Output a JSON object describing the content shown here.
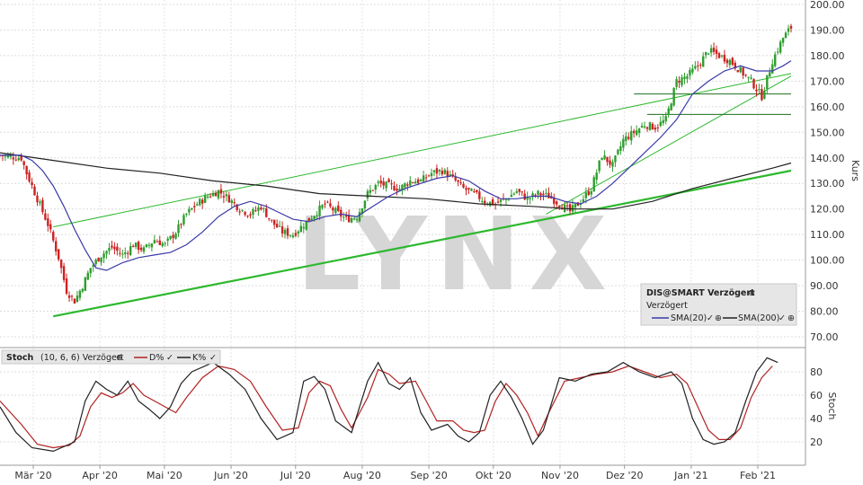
{
  "chart_data": [
    {
      "type": "candlestick",
      "symbol_label": "DIS@SMART Verzögert",
      "subtitle": "Verzögert",
      "ylabel": "Kurs",
      "ylim": [
        63,
        200
      ],
      "yticks": [
        "70.00",
        "80.00",
        "90.00",
        "100.00",
        "110.00",
        "120.00",
        "130.00",
        "140.00",
        "150.00",
        "160.00",
        "170.00",
        "180.00",
        "190.00",
        "200.00"
      ],
      "grid": true,
      "legend_position": "bottom-right",
      "watermark": "LYNX",
      "colors": {
        "up": "#2e9e2e",
        "down": "#cc2222",
        "sma20": "#3a3aa8",
        "sma200": "#222222",
        "trend": "#2db82d",
        "level": "#1f6f1f"
      },
      "x_start": "2020-02-20",
      "close_path": [
        [
          0,
          141
        ],
        [
          8,
          140
        ],
        [
          10,
          134
        ],
        [
          14,
          124
        ],
        [
          18,
          114
        ],
        [
          22,
          101
        ],
        [
          25,
          88
        ],
        [
          28,
          84
        ],
        [
          31,
          90
        ],
        [
          34,
          97
        ],
        [
          38,
          102
        ],
        [
          42,
          105
        ],
        [
          46,
          102
        ],
        [
          50,
          106
        ],
        [
          54,
          104
        ],
        [
          58,
          108
        ],
        [
          62,
          106
        ],
        [
          66,
          111
        ],
        [
          70,
          118
        ],
        [
          74,
          122
        ],
        [
          78,
          125
        ],
        [
          82,
          127
        ],
        [
          86,
          124
        ],
        [
          90,
          120
        ],
        [
          94,
          118
        ],
        [
          98,
          121
        ],
        [
          102,
          115
        ],
        [
          106,
          111
        ],
        [
          110,
          110
        ],
        [
          114,
          114
        ],
        [
          118,
          118
        ],
        [
          122,
          122
        ],
        [
          126,
          119
        ],
        [
          130,
          116
        ],
        [
          134,
          117
        ],
        [
          138,
          126
        ],
        [
          142,
          130
        ],
        [
          146,
          129
        ],
        [
          150,
          128
        ],
        [
          154,
          131
        ],
        [
          158,
          131
        ],
        [
          162,
          134
        ],
        [
          166,
          135
        ],
        [
          170,
          132
        ],
        [
          174,
          128
        ],
        [
          178,
          126
        ],
        [
          182,
          123
        ],
        [
          186,
          122
        ],
        [
          190,
          124
        ],
        [
          194,
          127
        ],
        [
          198,
          124
        ],
        [
          202,
          126
        ],
        [
          206,
          125
        ],
        [
          210,
          122
        ],
        [
          214,
          119
        ],
        [
          218,
          123
        ],
        [
          222,
          128
        ],
        [
          226,
          141
        ],
        [
          230,
          137
        ],
        [
          234,
          147
        ],
        [
          238,
          150
        ],
        [
          242,
          153
        ],
        [
          246,
          152
        ],
        [
          250,
          155
        ],
        [
          254,
          170
        ],
        [
          258,
          172
        ],
        [
          262,
          176
        ],
        [
          266,
          182
        ],
        [
          270,
          180
        ],
        [
          274,
          178
        ],
        [
          278,
          174
        ],
        [
          282,
          170
        ],
        [
          286,
          164
        ],
        [
          290,
          178
        ],
        [
          294,
          187
        ],
        [
          297,
          191
        ]
      ],
      "sma20_path": [
        [
          0,
          141
        ],
        [
          8,
          141
        ],
        [
          12,
          139
        ],
        [
          16,
          135
        ],
        [
          20,
          129
        ],
        [
          24,
          121
        ],
        [
          28,
          112
        ],
        [
          32,
          104
        ],
        [
          36,
          97
        ],
        [
          40,
          96
        ],
        [
          46,
          99
        ],
        [
          52,
          101
        ],
        [
          58,
          102
        ],
        [
          64,
          103
        ],
        [
          70,
          106
        ],
        [
          76,
          111
        ],
        [
          82,
          117
        ],
        [
          88,
          121
        ],
        [
          94,
          123
        ],
        [
          100,
          121
        ],
        [
          104,
          119
        ],
        [
          110,
          116
        ],
        [
          116,
          115
        ],
        [
          122,
          117
        ],
        [
          128,
          118
        ],
        [
          134,
          117
        ],
        [
          140,
          121
        ],
        [
          146,
          125
        ],
        [
          152,
          128
        ],
        [
          158,
          130
        ],
        [
          164,
          132
        ],
        [
          170,
          133
        ],
        [
          176,
          131
        ],
        [
          182,
          127
        ],
        [
          188,
          124
        ],
        [
          194,
          124
        ],
        [
          200,
          125
        ],
        [
          206,
          125
        ],
        [
          212,
          123
        ],
        [
          218,
          122
        ],
        [
          224,
          125
        ],
        [
          230,
          130
        ],
        [
          236,
          136
        ],
        [
          242,
          142
        ],
        [
          248,
          148
        ],
        [
          254,
          155
        ],
        [
          260,
          165
        ],
        [
          266,
          170
        ],
        [
          272,
          174
        ],
        [
          278,
          176
        ],
        [
          284,
          174
        ],
        [
          290,
          174
        ],
        [
          294,
          176
        ],
        [
          297,
          178
        ]
      ],
      "sma200_path": [
        [
          0,
          142
        ],
        [
          20,
          139
        ],
        [
          40,
          136
        ],
        [
          60,
          134
        ],
        [
          80,
          131
        ],
        [
          100,
          129
        ],
        [
          120,
          126
        ],
        [
          140,
          125
        ],
        [
          160,
          124
        ],
        [
          180,
          122
        ],
        [
          200,
          121
        ],
        [
          215,
          120
        ],
        [
          230,
          120
        ],
        [
          245,
          123
        ],
        [
          260,
          128
        ],
        [
          275,
          132
        ],
        [
          290,
          136
        ],
        [
          297,
          138
        ]
      ],
      "trendlines": [
        {
          "from": [
            20,
            78
          ],
          "to": [
            297,
            135
          ]
        },
        {
          "from": [
            20,
            113
          ],
          "to": [
            297,
            173
          ]
        },
        {
          "from": [
            205,
            118
          ],
          "to": [
            297,
            172
          ]
        }
      ],
      "levels": [
        {
          "y": 165,
          "x_from": 238,
          "x_to": 297
        },
        {
          "y": 157,
          "x_from": 243,
          "x_to": 297
        }
      ],
      "legend": [
        "SMA(20)",
        "SMA(200)"
      ]
    },
    {
      "type": "line",
      "title": "Stoch",
      "params": "(10, 6, 6) Verzögert",
      "ylabel": "Stoch",
      "ylim": [
        0,
        100
      ],
      "yticks": [
        "20",
        "40",
        "60",
        "80"
      ],
      "series": [
        {
          "name": "D%",
          "color": "#b22222",
          "points": [
            [
              0,
              55
            ],
            [
              8,
              35
            ],
            [
              14,
              18
            ],
            [
              20,
              15
            ],
            [
              26,
              17
            ],
            [
              30,
              25
            ],
            [
              34,
              50
            ],
            [
              38,
              62
            ],
            [
              42,
              58
            ],
            [
              46,
              62
            ],
            [
              50,
              70
            ],
            [
              54,
              60
            ],
            [
              58,
              55
            ],
            [
              62,
              50
            ],
            [
              66,
              45
            ],
            [
              70,
              58
            ],
            [
              76,
              75
            ],
            [
              82,
              85
            ],
            [
              88,
              82
            ],
            [
              94,
              72
            ],
            [
              100,
              50
            ],
            [
              106,
              30
            ],
            [
              112,
              32
            ],
            [
              116,
              62
            ],
            [
              120,
              72
            ],
            [
              124,
              68
            ],
            [
              128,
              48
            ],
            [
              132,
              32
            ],
            [
              138,
              58
            ],
            [
              142,
              82
            ],
            [
              146,
              78
            ],
            [
              150,
              70
            ],
            [
              156,
              72
            ],
            [
              160,
              55
            ],
            [
              164,
              38
            ],
            [
              170,
              38
            ],
            [
              174,
              30
            ],
            [
              178,
              28
            ],
            [
              182,
              30
            ],
            [
              186,
              55
            ],
            [
              190,
              70
            ],
            [
              194,
              60
            ],
            [
              198,
              45
            ],
            [
              202,
              25
            ],
            [
              206,
              45
            ],
            [
              212,
              72
            ],
            [
              218,
              75
            ],
            [
              224,
              78
            ],
            [
              230,
              80
            ],
            [
              236,
              85
            ],
            [
              242,
              80
            ],
            [
              248,
              75
            ],
            [
              254,
              78
            ],
            [
              258,
              70
            ],
            [
              262,
              50
            ],
            [
              266,
              30
            ],
            [
              270,
              22
            ],
            [
              274,
              22
            ],
            [
              278,
              32
            ],
            [
              282,
              58
            ],
            [
              286,
              75
            ],
            [
              290,
              85
            ]
          ]
        },
        {
          "name": "K%",
          "color": "#222222",
          "points": [
            [
              0,
              50
            ],
            [
              6,
              28
            ],
            [
              12,
              15
            ],
            [
              20,
              12
            ],
            [
              28,
              20
            ],
            [
              32,
              55
            ],
            [
              36,
              72
            ],
            [
              40,
              65
            ],
            [
              44,
              60
            ],
            [
              48,
              72
            ],
            [
              52,
              55
            ],
            [
              56,
              48
            ],
            [
              60,
              40
            ],
            [
              64,
              50
            ],
            [
              68,
              70
            ],
            [
              72,
              80
            ],
            [
              80,
              88
            ],
            [
              86,
              78
            ],
            [
              92,
              65
            ],
            [
              98,
              40
            ],
            [
              104,
              22
            ],
            [
              110,
              28
            ],
            [
              114,
              72
            ],
            [
              118,
              76
            ],
            [
              122,
              65
            ],
            [
              126,
              38
            ],
            [
              132,
              28
            ],
            [
              138,
              72
            ],
            [
              142,
              88
            ],
            [
              146,
              70
            ],
            [
              150,
              65
            ],
            [
              154,
              75
            ],
            [
              158,
              45
            ],
            [
              162,
              30
            ],
            [
              168,
              35
            ],
            [
              172,
              25
            ],
            [
              176,
              20
            ],
            [
              180,
              28
            ],
            [
              184,
              60
            ],
            [
              188,
              72
            ],
            [
              192,
              58
            ],
            [
              196,
              40
            ],
            [
              200,
              18
            ],
            [
              204,
              30
            ],
            [
              210,
              75
            ],
            [
              216,
              72
            ],
            [
              222,
              78
            ],
            [
              228,
              80
            ],
            [
              234,
              88
            ],
            [
              240,
              80
            ],
            [
              246,
              75
            ],
            [
              252,
              80
            ],
            [
              256,
              70
            ],
            [
              260,
              40
            ],
            [
              264,
              22
            ],
            [
              268,
              18
            ],
            [
              272,
              20
            ],
            [
              276,
              28
            ],
            [
              280,
              55
            ],
            [
              284,
              80
            ],
            [
              288,
              92
            ],
            [
              292,
              88
            ]
          ]
        }
      ]
    }
  ],
  "x_labels": [
    {
      "label": "Mär '20",
      "day": 10
    },
    {
      "label": "Apr '20",
      "day": 41
    },
    {
      "label": "Mai '20",
      "day": 71
    },
    {
      "label": "Jun '20",
      "day": 102
    },
    {
      "label": "Jul '20",
      "day": 132
    },
    {
      "label": "Aug '20",
      "day": 163
    },
    {
      "label": "Sep '20",
      "day": 194
    },
    {
      "label": "Okt '20",
      "day": 224
    },
    {
      "label": "Nov '20",
      "day": 255
    },
    {
      "label": "Dez '20",
      "day": 285
    },
    {
      "label": "Jan '21",
      "day": 316
    },
    {
      "label": "Feb '21",
      "day": 347
    }
  ]
}
